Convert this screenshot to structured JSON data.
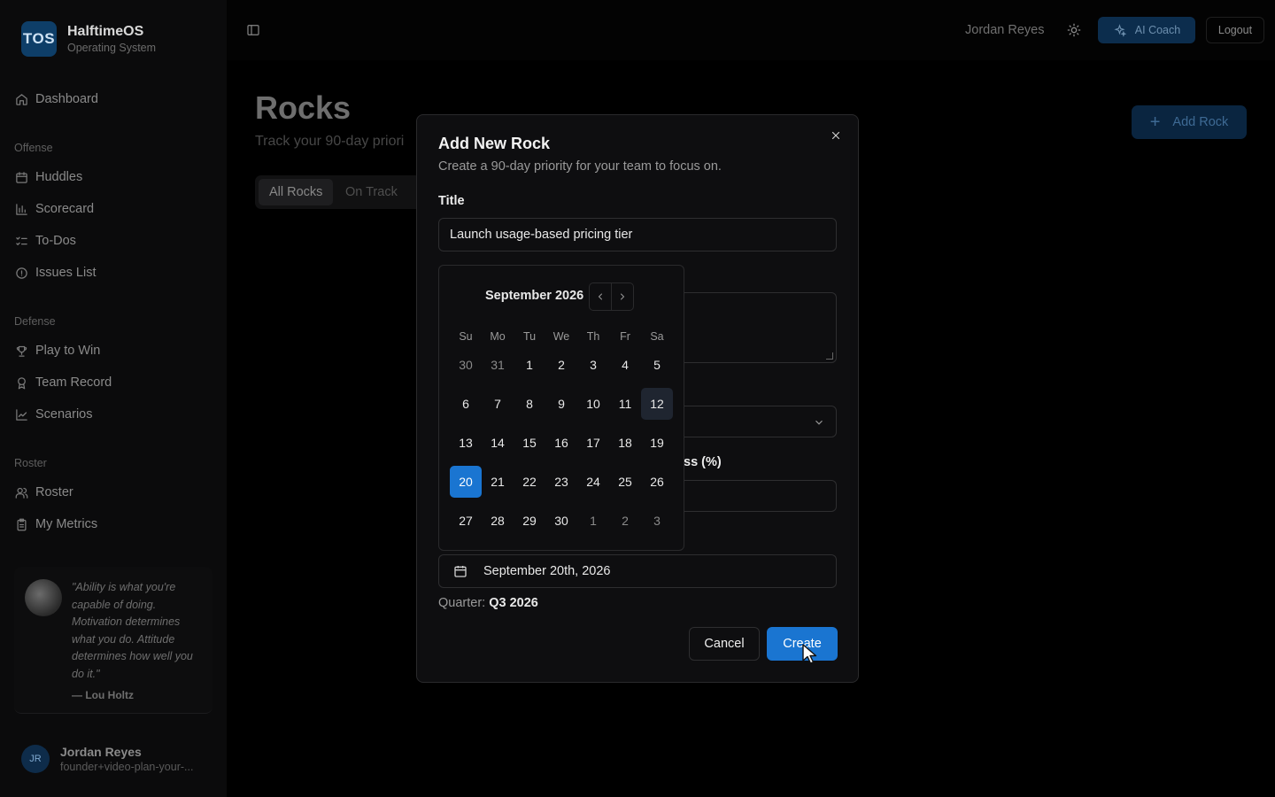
{
  "brand": {
    "logo_text": "TOS",
    "name": "HalftimeOS",
    "subtitle": "Operating System"
  },
  "sidebar": {
    "dashboard": "Dashboard",
    "groups": {
      "offense": "Offense",
      "defense": "Defense",
      "roster": "Roster"
    },
    "offense_items": [
      "Huddles",
      "Scorecard",
      "To-Dos",
      "Issues List"
    ],
    "defense_items": [
      "Play to Win",
      "Team Record",
      "Scenarios"
    ],
    "roster_items": [
      "Roster",
      "My Metrics"
    ],
    "quote": {
      "text": "\"Ability is what you're capable of doing. Motivation determines what you do. Attitude determines how well you do it.\"",
      "author": "— Lou Holtz"
    },
    "user": {
      "initials": "JR",
      "name": "Jordan Reyes",
      "email": "founder+video-plan-your-..."
    }
  },
  "topbar": {
    "user_name": "Jordan Reyes",
    "ai_coach_label": "AI Coach",
    "logout_label": "Logout"
  },
  "page": {
    "title": "Rocks",
    "subtitle": "Track your 90-day priori",
    "tabs": [
      "All Rocks",
      "On Track"
    ],
    "add_button_label": "Add Rock"
  },
  "modal": {
    "title": "Add New Rock",
    "description": "Create a 90-day priority for your team to focus on.",
    "title_label": "Title",
    "title_value": "Launch usage-based pricing tier",
    "progress_label_fragment": "ss (%)",
    "date_value": "September 20th, 2026",
    "quarter_label": "Quarter:",
    "quarter_value": "Q3 2026",
    "cancel_label": "Cancel",
    "create_label": "Create"
  },
  "calendar": {
    "month_label": "September 2026",
    "weekdays": [
      "Su",
      "Mo",
      "Tu",
      "We",
      "Th",
      "Fr",
      "Sa"
    ],
    "weeks": [
      [
        "30",
        "31",
        "1",
        "2",
        "3",
        "4",
        "5"
      ],
      [
        "6",
        "7",
        "8",
        "9",
        "10",
        "11",
        "12"
      ],
      [
        "13",
        "14",
        "15",
        "16",
        "17",
        "18",
        "19"
      ],
      [
        "20",
        "21",
        "22",
        "23",
        "24",
        "25",
        "26"
      ],
      [
        "27",
        "28",
        "29",
        "30",
        "1",
        "2",
        "3"
      ]
    ],
    "selected_day": "20",
    "today_day": "12"
  },
  "colors": {
    "accent": "#1a75d1",
    "background": "#000000",
    "modal_bg": "#0e0e10"
  }
}
